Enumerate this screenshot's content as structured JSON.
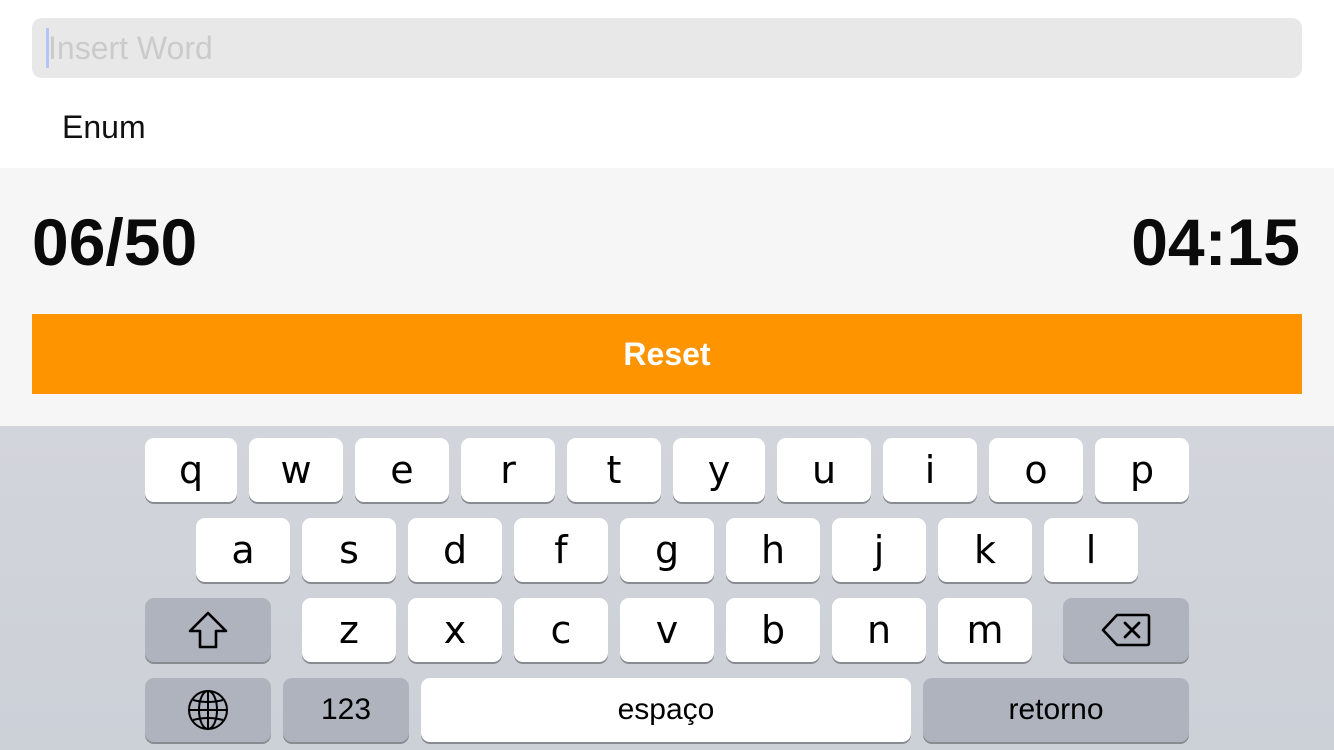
{
  "search": {
    "placeholder": "Insert Word",
    "value": ""
  },
  "list": {
    "items": [
      {
        "label": "Enum"
      }
    ]
  },
  "status": {
    "counter": "06/50",
    "timer": "04:15"
  },
  "actions": {
    "reset_label": "Reset"
  },
  "colors": {
    "accent": "#fe9500",
    "keyboard_bg": "#d2d5db",
    "fn_key": "#aeb3bd",
    "panel_bg": "#f6f6f6"
  },
  "keyboard": {
    "row1": [
      "q",
      "w",
      "e",
      "r",
      "t",
      "y",
      "u",
      "i",
      "o",
      "p"
    ],
    "row2": [
      "a",
      "s",
      "d",
      "f",
      "g",
      "h",
      "j",
      "k",
      "l"
    ],
    "row3": [
      "z",
      "x",
      "c",
      "v",
      "b",
      "n",
      "m"
    ],
    "shift_icon": "shift-arrow-icon",
    "backspace_icon": "backspace-icon",
    "globe_icon": "globe-icon",
    "numbers_label": "123",
    "space_label": "espaço",
    "return_label": "retorno"
  }
}
